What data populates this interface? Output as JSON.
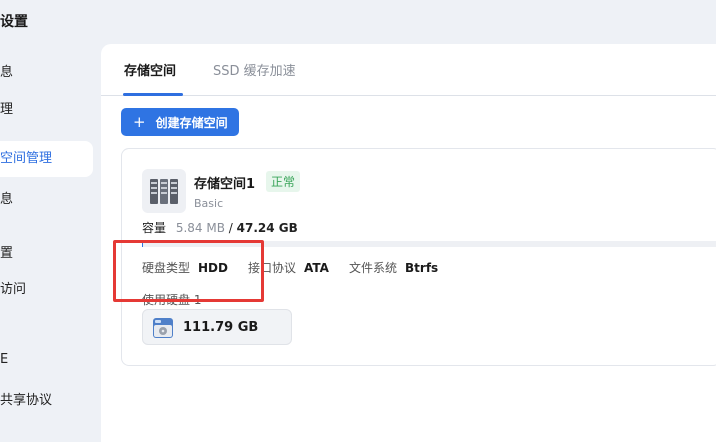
{
  "sidebar": {
    "title": "设置",
    "items": [
      {
        "label": "息"
      },
      {
        "label": "理"
      },
      {
        "label": "空间管理"
      },
      {
        "label": "息"
      },
      {
        "label": "置"
      },
      {
        "label": "访问"
      },
      {
        "label": "E"
      },
      {
        "label": "共享协议"
      }
    ]
  },
  "tabs": [
    {
      "label": "存储空间"
    },
    {
      "label": "SSD 缓存加速"
    }
  ],
  "toolbar": {
    "create_label": "创建存储空间"
  },
  "storage_card": {
    "title": "存储空间1",
    "status": "正常",
    "subtitle": "Basic",
    "capacity_label": "容量",
    "used": "5.84 MB",
    "separator": " / ",
    "total": "47.24 GB",
    "usage_fraction": 0.0001,
    "disk_type_label": "硬盘类型",
    "disk_type_value": "HDD",
    "interface_label": "接口协议",
    "interface_value": "ATA",
    "fs_label": "文件系统",
    "fs_value": "Btrfs",
    "used_disks_label": "使用硬盘 1",
    "disk_size": "111.79 GB"
  },
  "colors": {
    "accent": "#2f74e3",
    "status_ok": "#3aa55a",
    "highlight": "#e53935"
  },
  "icons": {
    "storage": "server-rack-icon",
    "disk": "hdd-icon",
    "plus": "plus-icon"
  }
}
